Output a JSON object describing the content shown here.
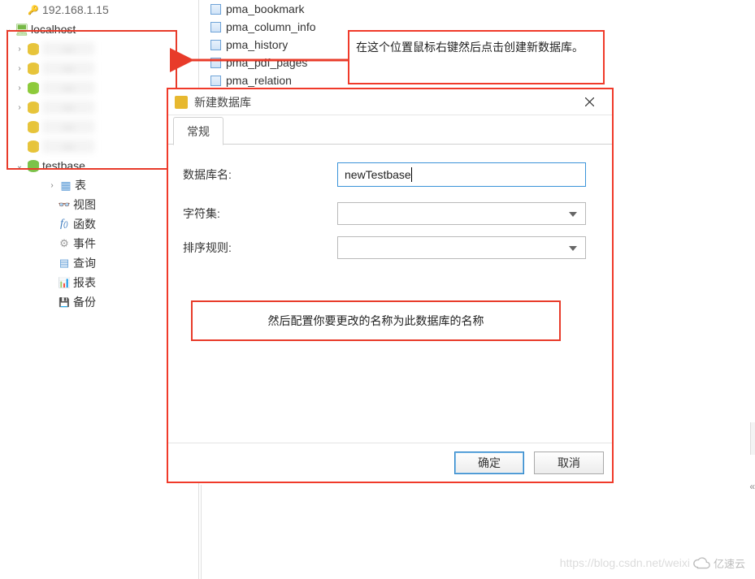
{
  "tree": {
    "conn_ip": "192.168.1.15",
    "localhost": "localhost",
    "testbase": "testbase",
    "children": {
      "tables": "表",
      "views": "视图",
      "functions": "函数",
      "events": "事件",
      "queries": "查询",
      "reports": "报表",
      "backups": "备份"
    }
  },
  "right_list": [
    "pma_bookmark",
    "pma_column_info",
    "pma_history",
    "pma_pdf_pages",
    "pma_relation"
  ],
  "callout1": "在这个位置鼠标右键然后点击创建新数据库。",
  "dialog": {
    "title": "新建数据库",
    "tab": "常规",
    "labels": {
      "dbname": "数据库名:",
      "charset": "字符集:",
      "collation": "排序规则:"
    },
    "dbname_value": "newTestbase",
    "ok": "确定",
    "cancel": "取消"
  },
  "callout2": "然后配置你要更改的名称为此数据库的名称",
  "watermark": "https://blog.csdn.net/weixi",
  "watermark_brand": "亿速云"
}
